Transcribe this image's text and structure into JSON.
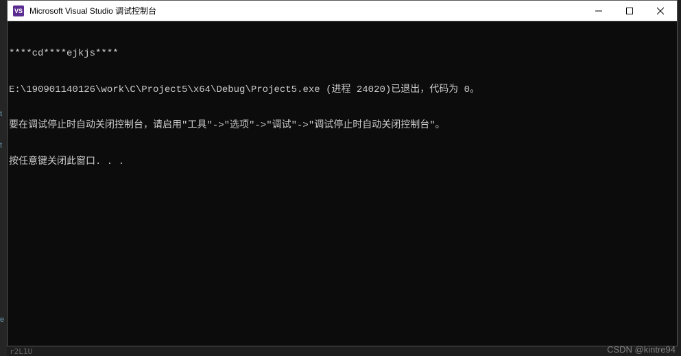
{
  "titlebar": {
    "app_icon_text": "VS",
    "title": "Microsoft Visual Studio 调试控制台"
  },
  "left_strip": {
    "item1": "t",
    "item2": "t",
    "item3": "e"
  },
  "console": {
    "line1": "****cd****ejkjs****",
    "line2": "E:\\190901140126\\work\\C\\Project5\\x64\\Debug\\Project5.exe (进程 24020)已退出，代码为 0。",
    "line3": "要在调试停止时自动关闭控制台，请启用\"工具\"->\"选项\"->\"调试\"->\"调试停止时自动关闭控制台\"。",
    "line4": "按任意键关闭此窗口. . ."
  },
  "watermark": "CSDN @kintre94",
  "bottom_fragment": "r2L1U"
}
